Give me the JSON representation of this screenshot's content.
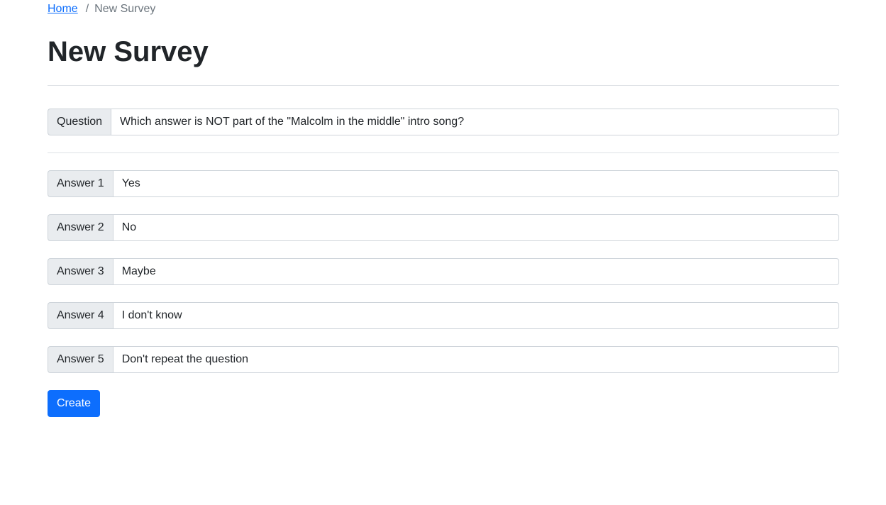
{
  "breadcrumb": {
    "home_label": "Home",
    "separator": "/",
    "current_label": "New Survey"
  },
  "page": {
    "title": "New Survey"
  },
  "question": {
    "label": "Question",
    "value": "Which answer is NOT part of the \"Malcolm in the middle\" intro song?"
  },
  "answers": [
    {
      "label": "Answer 1",
      "value": "Yes"
    },
    {
      "label": "Answer 2",
      "value": "No"
    },
    {
      "label": "Answer 3",
      "value": "Maybe"
    },
    {
      "label": "Answer 4",
      "value": "I don't know"
    },
    {
      "label": "Answer 5",
      "value": "Don't repeat the question"
    }
  ],
  "actions": {
    "create_label": "Create"
  },
  "colors": {
    "primary": "#0d6efd",
    "addon_bg": "#e9ecef",
    "border": "#ced4da",
    "text": "#212529",
    "muted": "#6c757d"
  }
}
